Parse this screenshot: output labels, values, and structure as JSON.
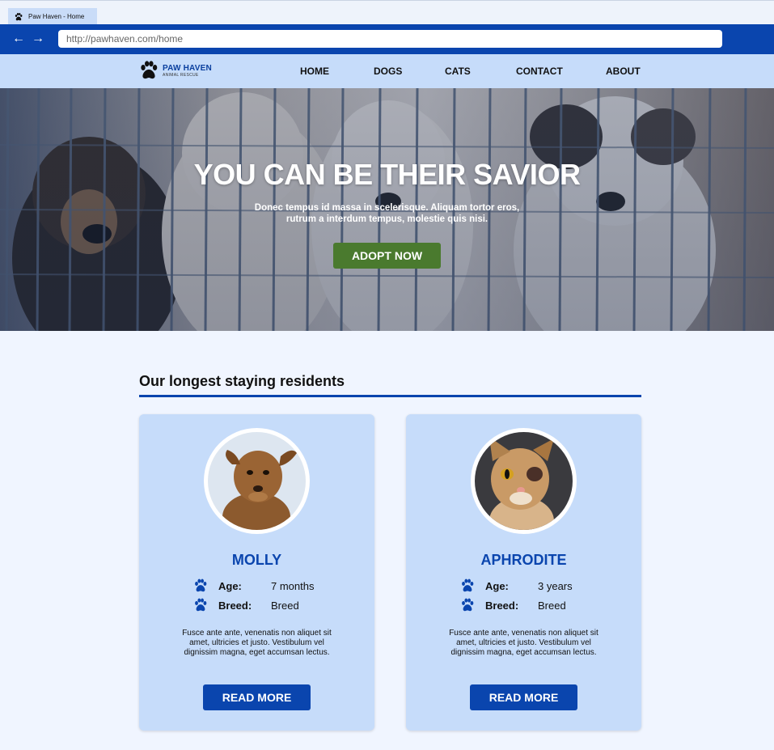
{
  "browser": {
    "tab_title": "Paw Haven - Home",
    "url": "http://pawhaven.com/home"
  },
  "site": {
    "brand": "PAW HAVEN",
    "tagline": "ANIMAL RESCUE",
    "nav": [
      "HOME",
      "DOGS",
      "CATS",
      "CONTACT",
      "ABOUT"
    ]
  },
  "hero": {
    "title": "YOU CAN BE THEIR SAVIOR",
    "subtitle": "Donec tempus id massa in scelerisque. Aliquam tortor eros, rutrum a interdum tempus, molestie quis nisi.",
    "cta": "ADOPT NOW"
  },
  "section": {
    "title": "Our longest staying residents"
  },
  "labels": {
    "age": "Age:",
    "breed": "Breed:",
    "read_more": "READ MORE"
  },
  "pets": [
    {
      "name": "MOLLY",
      "age": "7 months",
      "breed": "Breed",
      "description": "Fusce ante ante, venenatis non aliquet sit amet, ultricies et justo. Vestibulum vel dignissim magna, eget accumsan lectus."
    },
    {
      "name": "APHRODITE",
      "age": "3 years",
      "breed": "Breed",
      "description": "Fusce ante ante, venenatis non aliquet sit amet, ultricies et justo. Vestibulum vel dignissim magna, eget accumsan lectus."
    }
  ],
  "colors": {
    "primary_blue": "#0a45ae",
    "light_blue": "#c6dcfa",
    "page_bg": "#f0f5ff",
    "cta_green": "#4a7a2e"
  },
  "icons": {
    "paw": "paw-icon",
    "back": "arrow-left-icon",
    "forward": "arrow-right-icon"
  }
}
